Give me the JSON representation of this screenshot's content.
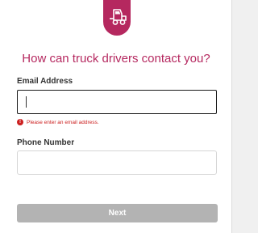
{
  "brand": {
    "logo_icon": "truck-icon",
    "accent_color": "#b5285f"
  },
  "heading": "How can truck drivers contact you?",
  "form": {
    "email": {
      "label": "Email Address",
      "value": "",
      "placeholder": "",
      "error": "Please enter an email address.",
      "error_icon": "alert-circle-icon",
      "error_icon_glyph": "!",
      "error_color": "#cc2020"
    },
    "phone": {
      "label": "Phone Number",
      "value": "",
      "placeholder": ""
    },
    "next_label": "Next",
    "next_button_color": "#b3b3b3"
  }
}
